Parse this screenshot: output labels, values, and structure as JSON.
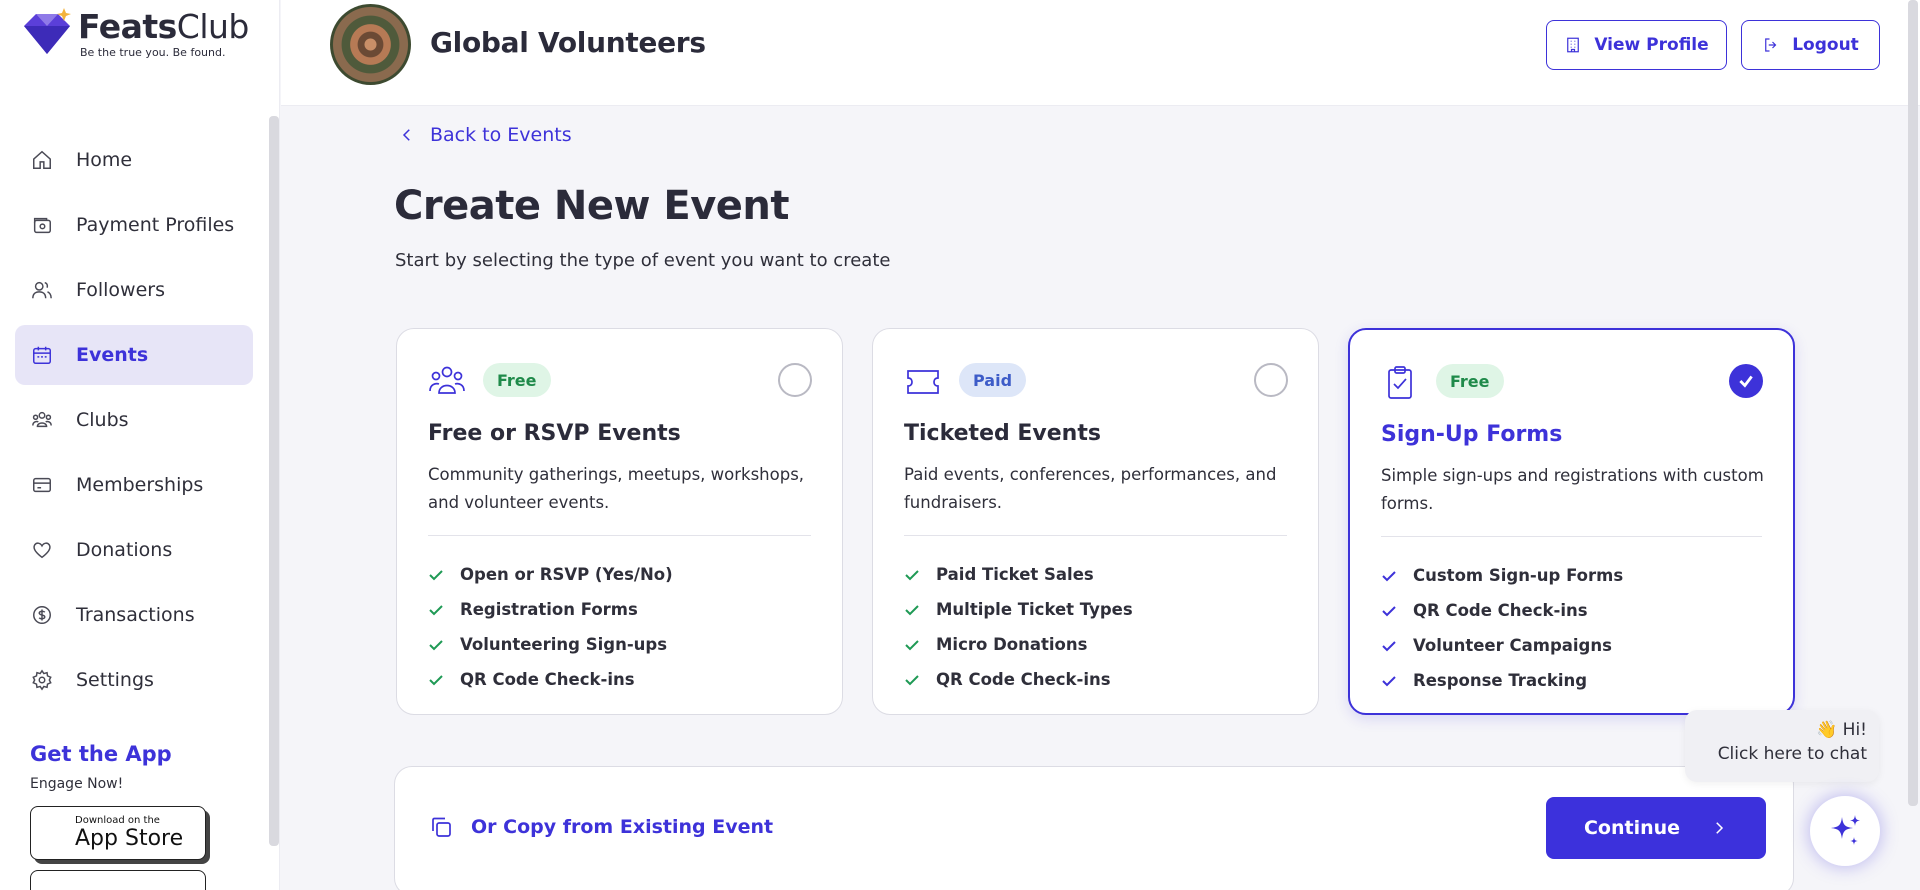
{
  "brand": {
    "name_bold": "Feats",
    "name_light": "Club",
    "tagline": "Be the true you. Be found."
  },
  "sidebar": {
    "items": [
      {
        "label": "Home",
        "icon": "home-icon",
        "active": false
      },
      {
        "label": "Payment Profiles",
        "icon": "wallet-icon",
        "active": false
      },
      {
        "label": "Followers",
        "icon": "users-icon",
        "active": false
      },
      {
        "label": "Events",
        "icon": "calendar-icon",
        "active": true
      },
      {
        "label": "Clubs",
        "icon": "group-icon",
        "active": false
      },
      {
        "label": "Memberships",
        "icon": "card-icon",
        "active": false
      },
      {
        "label": "Donations",
        "icon": "heart-icon",
        "active": false
      },
      {
        "label": "Transactions",
        "icon": "dollar-icon",
        "active": false
      },
      {
        "label": "Settings",
        "icon": "gear-icon",
        "active": false
      }
    ],
    "get_app": {
      "title": "Get the App",
      "subtitle": "Engage Now!",
      "appstore_small": "Download on the",
      "appstore_big": "App Store"
    }
  },
  "header": {
    "org_name": "Global Volunteers",
    "view_profile": "View Profile",
    "logout": "Logout"
  },
  "main": {
    "back_label": "Back to Events",
    "title": "Create New Event",
    "subtitle": "Start by selecting the type of event you want to create",
    "cards": [
      {
        "badge": "Free",
        "title": "Free or RSVP Events",
        "description": "Community gatherings, meetups, workshops, and volunteer events.",
        "features": [
          "Open or RSVP (Yes/No)",
          "Registration Forms",
          "Volunteering Sign-ups",
          "QR Code Check-ins"
        ],
        "selected": false
      },
      {
        "badge": "Paid",
        "title": "Ticketed Events",
        "description": "Paid events, conferences, performances, and fundraisers.",
        "features": [
          "Paid Ticket Sales",
          "Multiple Ticket Types",
          "Micro Donations",
          "QR Code Check-ins"
        ],
        "selected": false
      },
      {
        "badge": "Free",
        "title": "Sign-Up Forms",
        "description": "Simple sign-ups and registrations with custom forms.",
        "features": [
          "Custom Sign-up Forms",
          "QR Code Check-ins",
          "Volunteer Campaigns",
          "Response Tracking"
        ],
        "selected": true
      }
    ],
    "copy_label": "Or Copy from Existing Event",
    "continue_label": "Continue"
  },
  "chat": {
    "greeting": "👋 Hi!",
    "cta": "Click here to chat"
  },
  "colors": {
    "accent": "#3d32d9",
    "free_badge_bg": "#dff5e6",
    "paid_badge_bg": "#dde6f8",
    "check_green": "#1f9a55"
  }
}
